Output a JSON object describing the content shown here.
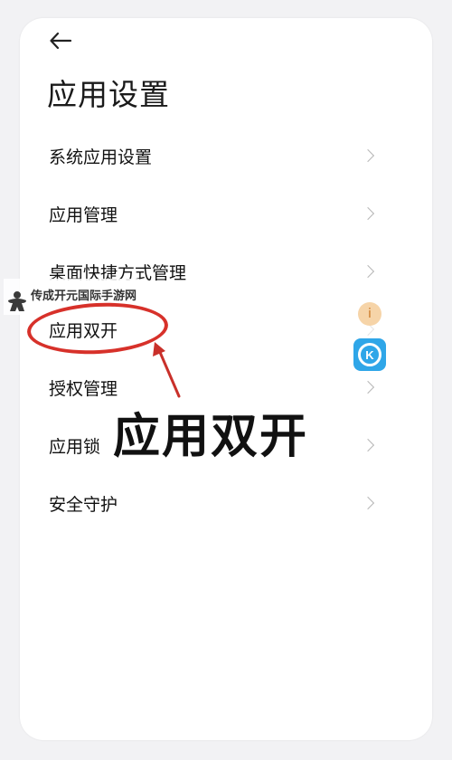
{
  "header": {
    "back_icon": "arrow-left-icon",
    "title": "应用设置"
  },
  "settings": {
    "items": [
      {
        "label": "系统应用设置"
      },
      {
        "label": "应用管理"
      },
      {
        "label": "桌面快捷方式管理"
      },
      {
        "label": "应用双开"
      },
      {
        "label": "授权管理"
      },
      {
        "label": "应用锁"
      },
      {
        "label": "安全守护"
      }
    ]
  },
  "annotation": {
    "caption": "应用双开",
    "color": "#d7312a"
  },
  "watermark": {
    "text": "传成开元国际手游网"
  },
  "floating": {
    "app_a_glyph": "i",
    "app_k_glyph": "K",
    "app_k_color": "#2fa6e8"
  }
}
